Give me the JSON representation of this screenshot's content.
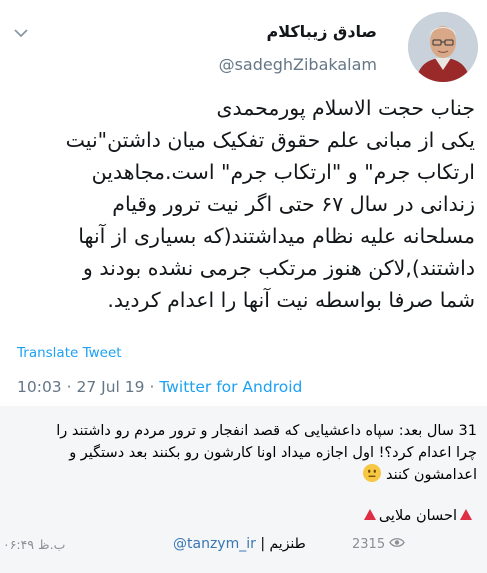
{
  "tweet": {
    "author_name": "صادق زیباکلام",
    "author_handle": "@sadeghZibakalam",
    "body_lines": [
      "جناب حجت الاسلام پورمحمدی",
      "یکی از مبانی علم حقوق تفکیک میان داشتن\"نیت",
      "ارتکاب جرم\" و \"ارتکاب جرم\" است.مجاهدین",
      "زندانی در سال ۶۷ حتی اگر نیت ترور وقیام",
      "مسلحانه علیه نظام میداشتند(که بسیاری از آنها",
      "داشتند),لاکن هنوز مرتکب جرمی نشده بودند و",
      "شما صرفا بواسطه نیت آنها را اعدام کردید."
    ],
    "translate_label": "Translate Tweet",
    "time": "10:03",
    "date": "27 Jul 19",
    "separator": "·",
    "app": "Twitter for Android"
  },
  "caption": {
    "lines": [
      "31 سال بعد: سپاه داعشیایی که قصد انفجار و ترور مردم رو داشتند را",
      "چرا اعدام کرد؟! اول اجازه میداد اونا کارشون رو بکنند بعد دستگیر و",
      "اعدامشون کنند"
    ],
    "emoji_name": "neutral-face-emoji",
    "signature": "احسان ملایی"
  },
  "footer": {
    "channel_label": "طنزیم",
    "channel_separator": "|",
    "channel_link": "@tanzym_ir",
    "views": "2315",
    "time": "ب.ظ ۰۶:۴۹"
  },
  "colors": {
    "link_blue": "#1da1f2",
    "muted": "#657786",
    "caption_bg": "#f5f6f7",
    "triangle_red": "#dd2e44"
  }
}
